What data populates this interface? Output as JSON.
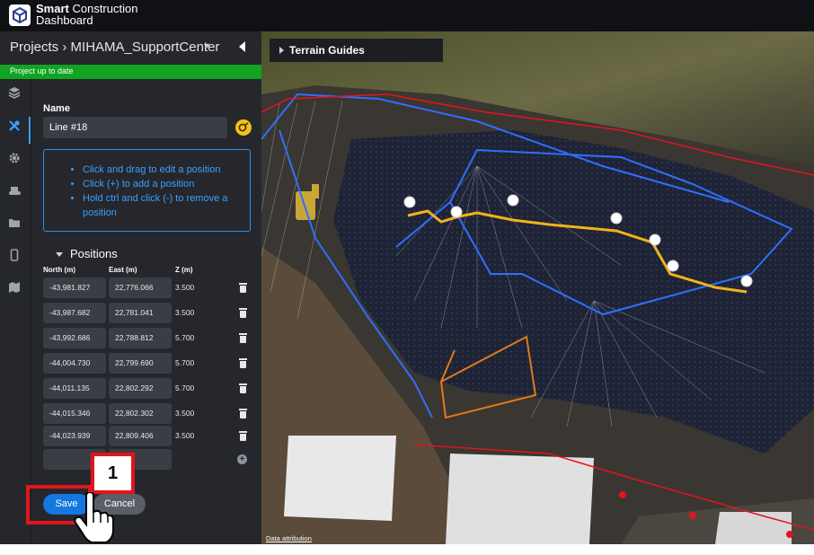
{
  "app": {
    "brand_bold": "Smart",
    "brand_rest": " Construction",
    "brand_line2": "Dashboard"
  },
  "header": {
    "projects_label": "Projects",
    "breadcrumb_sep": " › ",
    "project_name": "MIHAMA_SupportCenter",
    "status": "Project up to date"
  },
  "rail": {
    "icons": [
      "layers-icon",
      "tools-icon",
      "settings-icon",
      "machine-icon",
      "folder-icon",
      "device-icon",
      "map-icon"
    ]
  },
  "form": {
    "name_label": "Name",
    "name_value": "Line #18",
    "help": [
      "Click and drag to edit a position",
      "Click (+) to add a position",
      "Hold ctrl and click (-) to remove a position"
    ],
    "positions_label": "Positions",
    "columns": [
      "North (m)",
      "East (m)",
      "Z (m)"
    ],
    "rows": [
      {
        "north": "-43,981.827",
        "east": "22,776.066",
        "z": "3.500"
      },
      {
        "north": "-43,987.682",
        "east": "22,781.041",
        "z": "3.500"
      },
      {
        "north": "-43,992.686",
        "east": "22,788.812",
        "z": "5.700"
      },
      {
        "north": "-44,004.730",
        "east": "22,799.690",
        "z": "5.700"
      },
      {
        "north": "-44,011.135",
        "east": "22,802.292",
        "z": "5.700"
      },
      {
        "north": "-44,015.346",
        "east": "22,802.302",
        "z": "3.500"
      },
      {
        "north": "-44,023.939",
        "east": "22,809.406",
        "z": "3.500"
      }
    ],
    "add_symbol": "+",
    "save_label": "Save",
    "cancel_label": "Cancel"
  },
  "annotation": {
    "step_number": "1",
    "highlight_color": "#e3141c"
  },
  "map": {
    "terrain_guides_label": "Terrain Guides",
    "attribution": "Data attribution",
    "colors": {
      "guide_lines": "#2f6fff",
      "selected_line": "#f2b21b",
      "orange_lines": "#e07a1a",
      "boundary": "#e3141c"
    }
  }
}
